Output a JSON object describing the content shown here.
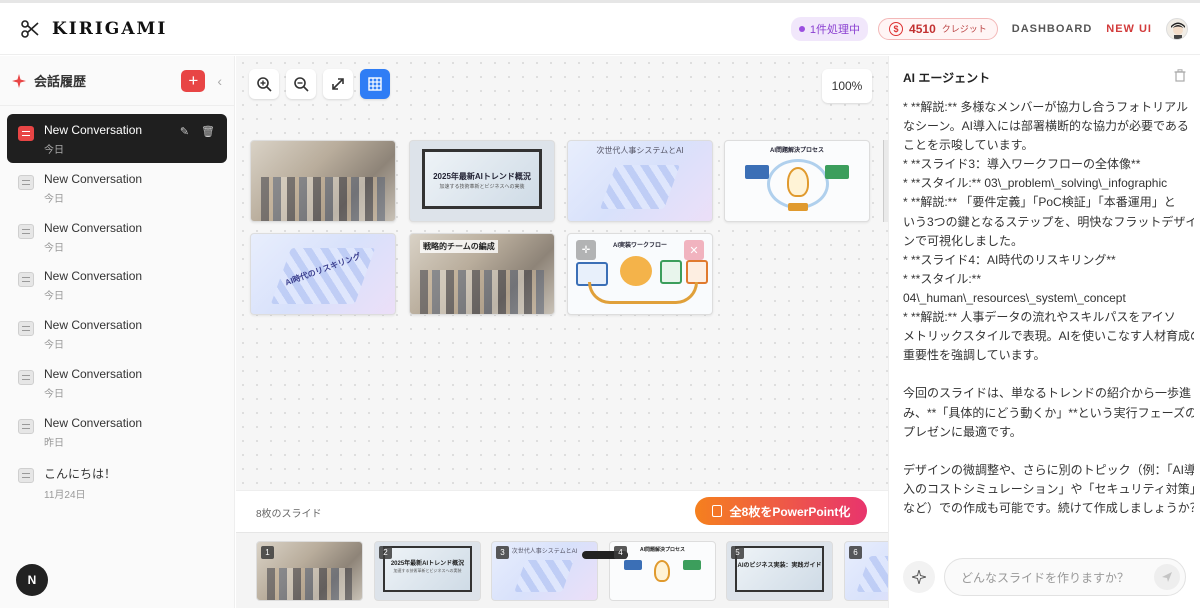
{
  "header": {
    "logo_text": "KIRIGAMI",
    "processing_label": "1件処理中",
    "credits_amount": "4510",
    "credits_unit": "クレジット",
    "credits_symbol": "$",
    "nav_dashboard": "DASHBOARD",
    "nav_new_ui": "NEW UI",
    "colors": {
      "accent": "#e84545",
      "processing": "#8a3fd1"
    }
  },
  "sidebar": {
    "title": "会話履歴",
    "add_label": "+",
    "collapse_label": "‹",
    "conversations": [
      {
        "name": "New Conversation",
        "date": "今日",
        "active": true
      },
      {
        "name": "New Conversation",
        "date": "今日"
      },
      {
        "name": "New Conversation",
        "date": "今日"
      },
      {
        "name": "New Conversation",
        "date": "今日"
      },
      {
        "name": "New Conversation",
        "date": "今日"
      },
      {
        "name": "New Conversation",
        "date": "今日"
      },
      {
        "name": "New Conversation",
        "date": "昨日"
      },
      {
        "name": "こんにちは！",
        "date": "11月24日"
      }
    ],
    "badge_label": "N"
  },
  "canvas": {
    "zoom_level": "100%",
    "tools": [
      "zoom-in",
      "zoom-out",
      "fullscreen",
      "grid"
    ],
    "slides": [
      {
        "type": "photo",
        "caption": ""
      },
      {
        "type": "monitor",
        "title": "2025年最新AIトレンド概況",
        "subtitle": "加速する技術革新とビジネスへの実装"
      },
      {
        "type": "iso",
        "title": "次世代人事システムとAI"
      },
      {
        "type": "info",
        "title": "AI問題解決プロセス"
      },
      {
        "type": "iso",
        "title": "AI時代のリスキリング"
      },
      {
        "type": "photo",
        "title": "戦略的チームの編成"
      },
      {
        "type": "flow",
        "title": "AI実装ワークフロー"
      }
    ],
    "slide_count_label": "8枚のスライド",
    "ppt_button_label": "全8枚をPowerPoint化"
  },
  "thumbnails": [
    {
      "num": "1",
      "type": "photo"
    },
    {
      "num": "2",
      "type": "monitor",
      "title": "2025年最新AIトレンド概況",
      "subtitle": "加速する技術革新とビジネスへの実装"
    },
    {
      "num": "3",
      "type": "iso",
      "title": "次世代人事システムとAI"
    },
    {
      "num": "4",
      "type": "info",
      "title": "AI問題解決プロセス"
    },
    {
      "num": "5",
      "type": "monitor",
      "title": "AIのビジネス実装：実践ガイド"
    },
    {
      "num": "6",
      "type": "iso"
    }
  ],
  "agent": {
    "title": "AI エージェント",
    "lines": [
      "    *   **解説:** 多様なメンバーが協力し合うフォトリアル",
      "なシーン。AI導入には部署横断的な協力が必要である",
      "ことを示唆しています。",
      "*   **スライド3：導入ワークフローの全体像**",
      "    *   **スタイル:** 03\\_problem\\_solving\\_infographic",
      "    *   **解説:** 「要件定義」「PoC検証」「本番運用」と",
      "いう3つの鍵となるステップを、明快なフラットデザイ",
      "ンで可視化しました。",
      "*   **スライド4：AI時代のリスキリング**",
      "    *   **スタイル:**",
      "04\\_human\\_resources\\_system\\_concept",
      "    *   **解説:** 人事データの流れやスキルパスをアイソ",
      "メトリックスタイルで表現。AIを使いこなす人材育成の",
      "重要性を強調しています。",
      "",
      "今回のスライドは、単なるトレンドの紹介から一歩進",
      "み、**「具体的にどう動くか」**という実行フェーズの",
      "プレゼンに最適です。",
      "",
      "デザインの微調整や、さらに別のトピック（例：「AI導",
      "入のコストシミュレーション」や「セキュリティ対策」",
      "など）での作成も可能です。続けて作成しましょうか？"
    ],
    "input_placeholder": "どんなスライドを作りますか？"
  }
}
